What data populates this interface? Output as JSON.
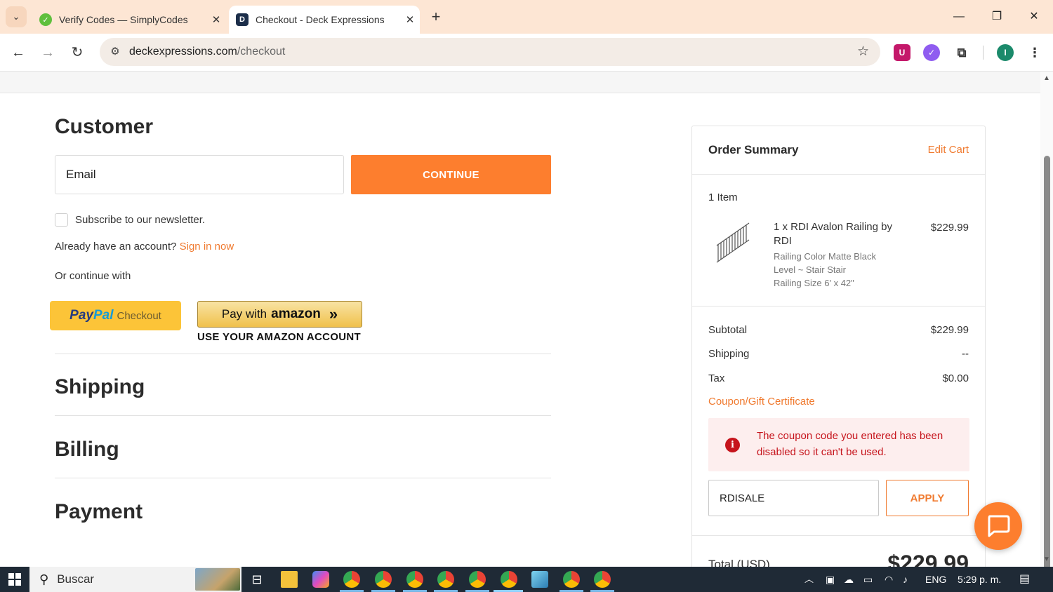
{
  "browser": {
    "tabs": [
      {
        "title": "Verify Codes — SimplyCodes",
        "active": false
      },
      {
        "title": "Checkout - Deck Expressions",
        "active": true
      }
    ],
    "url_domain": "deckexpressions.com",
    "url_path": "/checkout",
    "profile_initial": "I"
  },
  "customer": {
    "heading": "Customer",
    "email_placeholder": "Email",
    "continue_label": "CONTINUE",
    "newsletter_label": "Subscribe to our newsletter.",
    "account_prompt": "Already have an account?",
    "sign_in_label": "Sign in now",
    "continue_with_label": "Or continue with",
    "paypal_logo_pay": "Pay",
    "paypal_logo_pal": "Pal",
    "paypal_text": "Checkout",
    "amazon_prefix": "Pay with",
    "amazon_word": "amazon",
    "amazon_sub": "USE YOUR AMAZON ACCOUNT"
  },
  "sections": {
    "shipping": "Shipping",
    "billing": "Billing",
    "payment": "Payment"
  },
  "summary": {
    "title": "Order Summary",
    "edit_cart": "Edit Cart",
    "item_count": "1 Item",
    "item": {
      "name": "1 x RDI Avalon Railing by RDI",
      "price": "$229.99",
      "options": [
        "Railing Color Matte Black",
        "Level ~ Stair Stair",
        "Railing Size 6' x 42\""
      ]
    },
    "subtotal_label": "Subtotal",
    "subtotal_value": "$229.99",
    "shipping_label": "Shipping",
    "shipping_value": "--",
    "tax_label": "Tax",
    "tax_value": "$0.00",
    "coupon_link": "Coupon/Gift Certificate",
    "error_icon": "i",
    "error_message": "The coupon code you entered has been disabled so it can't be used.",
    "coupon_value": "RDISALE",
    "apply_label": "APPLY",
    "total_label": "Total (USD)",
    "total_value": "$229.99"
  },
  "taskbar": {
    "search_placeholder": "Buscar",
    "language": "ENG",
    "time": "5:29 p. m."
  },
  "colors": {
    "accent_orange": "#fd7e2e",
    "error_red": "#c6141c",
    "tabbar_bg": "#fde6d4"
  }
}
